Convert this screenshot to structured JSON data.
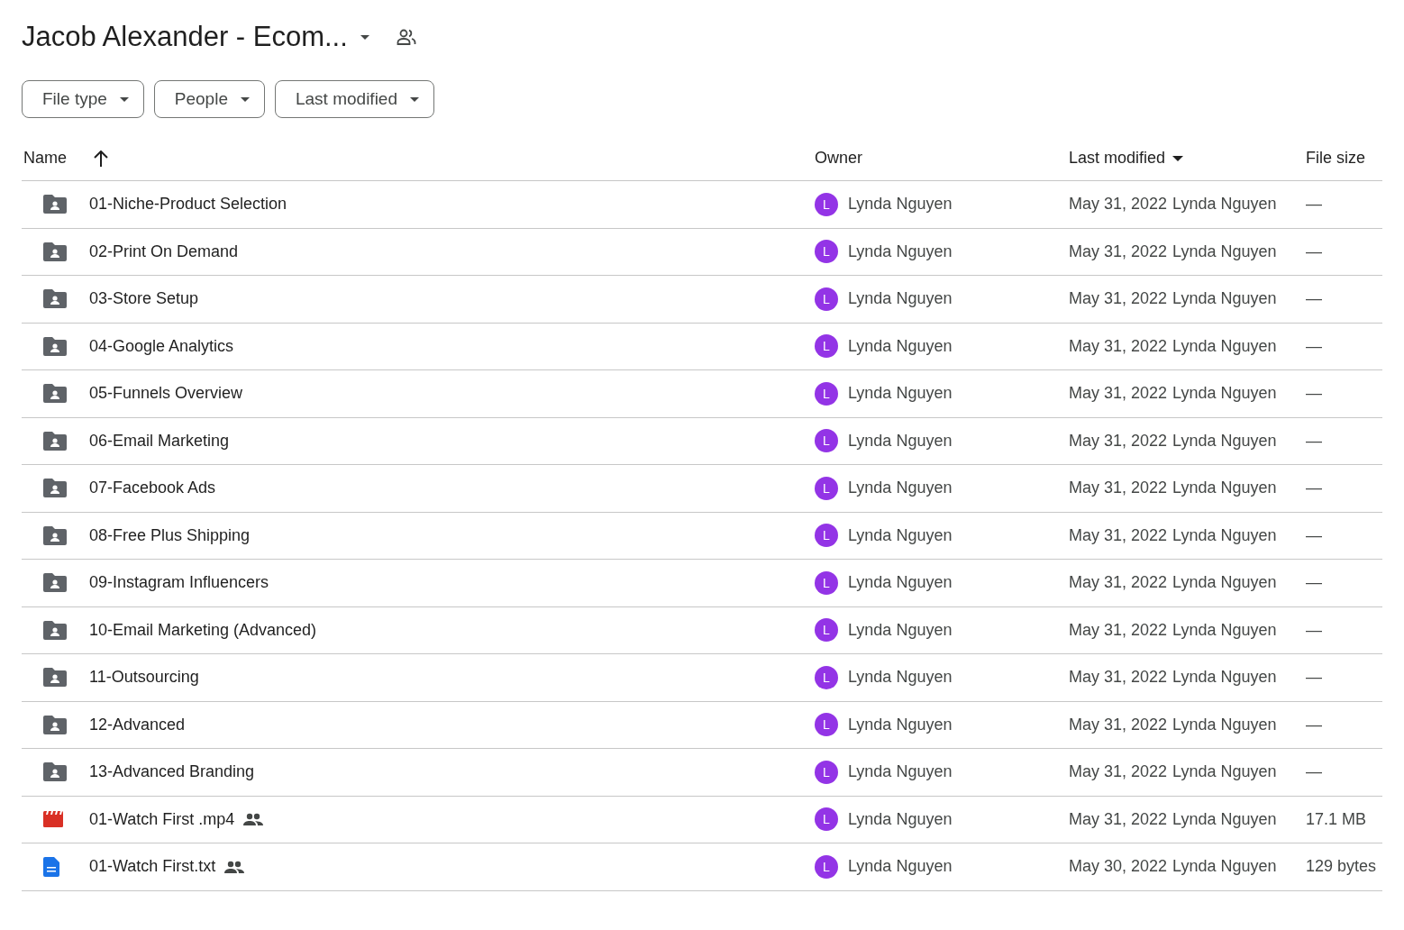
{
  "header": {
    "title": "Jacob Alexander - Ecom..."
  },
  "filters": [
    {
      "label": "File type"
    },
    {
      "label": "People"
    },
    {
      "label": "Last modified"
    }
  ],
  "table": {
    "columns": [
      {
        "label": "Name",
        "sorted": true,
        "ascending": true
      },
      {
        "label": "Owner",
        "sorted": false
      },
      {
        "label": "Last modified",
        "sorted": true,
        "ascending": false
      },
      {
        "label": "File size",
        "sorted": false
      }
    ],
    "rows": [
      {
        "kind": "folder",
        "name": "01-Niche-Product Selection",
        "shared": false,
        "owner_initial": "L",
        "owner": "Lynda Nguyen",
        "modified": "May 31, 2022",
        "modified_by": "Lynda Nguyen",
        "size": "—"
      },
      {
        "kind": "folder",
        "name": "02-Print On Demand",
        "shared": false,
        "owner_initial": "L",
        "owner": "Lynda Nguyen",
        "modified": "May 31, 2022",
        "modified_by": "Lynda Nguyen",
        "size": "—"
      },
      {
        "kind": "folder",
        "name": "03-Store Setup",
        "shared": false,
        "owner_initial": "L",
        "owner": "Lynda Nguyen",
        "modified": "May 31, 2022",
        "modified_by": "Lynda Nguyen",
        "size": "—"
      },
      {
        "kind": "folder",
        "name": "04-Google Analytics",
        "shared": false,
        "owner_initial": "L",
        "owner": "Lynda Nguyen",
        "modified": "May 31, 2022",
        "modified_by": "Lynda Nguyen",
        "size": "—"
      },
      {
        "kind": "folder",
        "name": "05-Funnels Overview",
        "shared": false,
        "owner_initial": "L",
        "owner": "Lynda Nguyen",
        "modified": "May 31, 2022",
        "modified_by": "Lynda Nguyen",
        "size": "—"
      },
      {
        "kind": "folder",
        "name": "06-Email Marketing",
        "shared": false,
        "owner_initial": "L",
        "owner": "Lynda Nguyen",
        "modified": "May 31, 2022",
        "modified_by": "Lynda Nguyen",
        "size": "—"
      },
      {
        "kind": "folder",
        "name": "07-Facebook Ads",
        "shared": false,
        "owner_initial": "L",
        "owner": "Lynda Nguyen",
        "modified": "May 31, 2022",
        "modified_by": "Lynda Nguyen",
        "size": "—"
      },
      {
        "kind": "folder",
        "name": "08-Free Plus Shipping",
        "shared": false,
        "owner_initial": "L",
        "owner": "Lynda Nguyen",
        "modified": "May 31, 2022",
        "modified_by": "Lynda Nguyen",
        "size": "—"
      },
      {
        "kind": "folder",
        "name": "09-Instagram Influencers",
        "shared": false,
        "owner_initial": "L",
        "owner": "Lynda Nguyen",
        "modified": "May 31, 2022",
        "modified_by": "Lynda Nguyen",
        "size": "—"
      },
      {
        "kind": "folder",
        "name": "10-Email Marketing (Advanced)",
        "shared": false,
        "owner_initial": "L",
        "owner": "Lynda Nguyen",
        "modified": "May 31, 2022",
        "modified_by": "Lynda Nguyen",
        "size": "—"
      },
      {
        "kind": "folder",
        "name": "11-Outsourcing",
        "shared": false,
        "owner_initial": "L",
        "owner": "Lynda Nguyen",
        "modified": "May 31, 2022",
        "modified_by": "Lynda Nguyen",
        "size": "—"
      },
      {
        "kind": "folder",
        "name": "12-Advanced",
        "shared": false,
        "owner_initial": "L",
        "owner": "Lynda Nguyen",
        "modified": "May 31, 2022",
        "modified_by": "Lynda Nguyen",
        "size": "—"
      },
      {
        "kind": "folder",
        "name": "13-Advanced Branding",
        "shared": false,
        "owner_initial": "L",
        "owner": "Lynda Nguyen",
        "modified": "May 31, 2022",
        "modified_by": "Lynda Nguyen",
        "size": "—"
      },
      {
        "kind": "video",
        "name": "01-Watch First .mp4",
        "shared": true,
        "owner_initial": "L",
        "owner": "Lynda Nguyen",
        "modified": "May 31, 2022",
        "modified_by": "Lynda Nguyen",
        "size": "17.1 MB"
      },
      {
        "kind": "document",
        "name": "01-Watch First.txt",
        "shared": true,
        "owner_initial": "L",
        "owner": "Lynda Nguyen",
        "modified": "May 30, 2022",
        "modified_by": "Lynda Nguyen",
        "size": "129 bytes"
      }
    ]
  }
}
